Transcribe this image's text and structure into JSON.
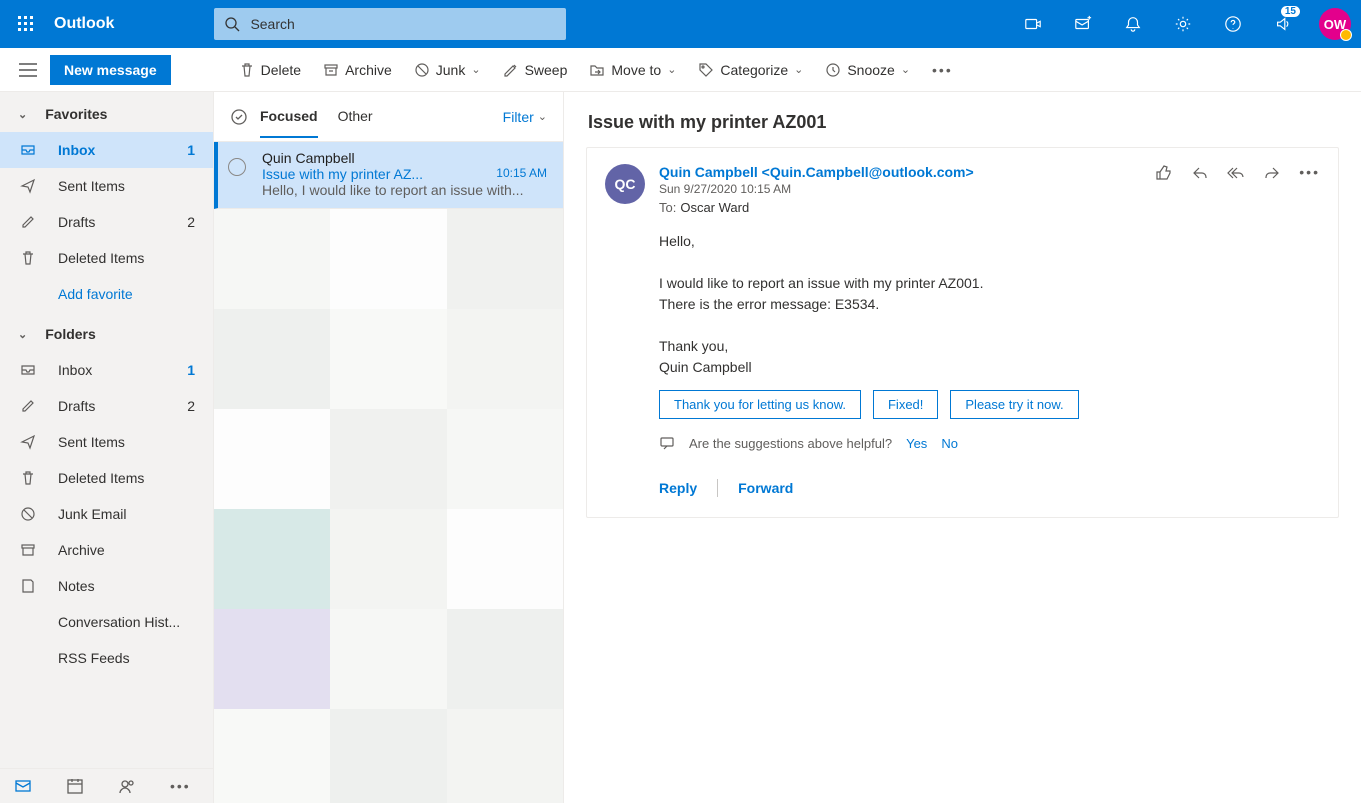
{
  "top": {
    "appname": "Outlook",
    "search_placeholder": "Search",
    "notif_count": "15",
    "avatar_initials": "OW"
  },
  "cmd": {
    "newmsg": "New message",
    "delete": "Delete",
    "archive": "Archive",
    "junk": "Junk",
    "sweep": "Sweep",
    "moveto": "Move to",
    "categorize": "Categorize",
    "snooze": "Snooze"
  },
  "nav": {
    "favorites_head": "Favorites",
    "folders_head": "Folders",
    "add_favorite": "Add favorite",
    "fav": {
      "inbox": {
        "label": "Inbox",
        "count": "1"
      },
      "sent": {
        "label": "Sent Items"
      },
      "drafts": {
        "label": "Drafts",
        "count": "2"
      },
      "deleted": {
        "label": "Deleted Items"
      }
    },
    "folders": {
      "inbox": {
        "label": "Inbox",
        "count": "1"
      },
      "drafts": {
        "label": "Drafts",
        "count": "2"
      },
      "sent": {
        "label": "Sent Items"
      },
      "deleted": {
        "label": "Deleted Items"
      },
      "junk": {
        "label": "Junk Email"
      },
      "archive": {
        "label": "Archive"
      },
      "notes": {
        "label": "Notes"
      },
      "conv": {
        "label": "Conversation Hist..."
      },
      "rss": {
        "label": "RSS Feeds"
      }
    }
  },
  "list": {
    "tab_focused": "Focused",
    "tab_other": "Other",
    "filter": "Filter",
    "item": {
      "from": "Quin Campbell",
      "subject": "Issue with my printer AZ...",
      "time": "10:15 AM",
      "preview": "Hello, I would like to report an issue with..."
    }
  },
  "read": {
    "subject": "Issue with my printer AZ001",
    "sender_initials": "QC",
    "sender_line": "Quin Campbell <Quin.Campbell@outlook.com>",
    "date": "Sun 9/27/2020 10:15 AM",
    "to_label": "To:",
    "to_value": "Oscar Ward",
    "body_line1": "Hello,",
    "body_line2": "I would like to report an issue with my printer AZ001.",
    "body_line3": "There is the error message: E3534.",
    "body_line4": "Thank you,",
    "body_line5": "Quin Campbell",
    "suggest1": "Thank you for letting us know.",
    "suggest2": "Fixed!",
    "suggest3": "Please try it now.",
    "suggest_q": "Are the suggestions above helpful?",
    "yes": "Yes",
    "no": "No",
    "reply": "Reply",
    "forward": "Forward"
  }
}
